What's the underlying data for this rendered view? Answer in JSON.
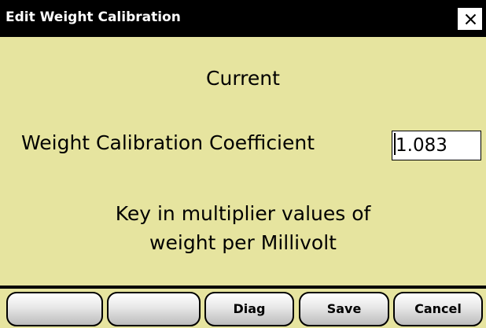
{
  "window": {
    "title": "Edit Weight Calibration",
    "close_icon": "close-icon",
    "colors": {
      "background": "#e6e49f",
      "titlebar": "#000000",
      "title_text": "#ffffff"
    }
  },
  "main": {
    "heading": "Current",
    "field_label": "Weight Calibration Coefficient",
    "field_value": "1.083",
    "note_line1": "Key in multiplier values of",
    "note_line2": "weight per Millivolt"
  },
  "buttons": {
    "button1_label": "",
    "button2_label": "",
    "diag_label": "Diag",
    "save_label": "Save",
    "cancel_label": "Cancel"
  }
}
